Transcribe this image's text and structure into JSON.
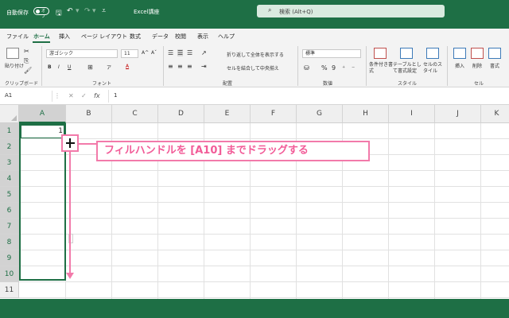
{
  "titlebar": {
    "autosave_label": "自動保存",
    "autosave_state": "オフ",
    "doc_title": "Excel講座",
    "search_placeholder": "検索 (Alt+Q)"
  },
  "menu": {
    "tabs": [
      "ファイル",
      "ホーム",
      "挿入",
      "ページ レイアウト",
      "数式",
      "データ",
      "校閲",
      "表示",
      "ヘルプ"
    ],
    "active": "ホーム"
  },
  "ribbon": {
    "clipboard": {
      "paste": "貼り付け",
      "label": "クリップボード"
    },
    "font": {
      "name": "游ゴシック",
      "size": "11",
      "label": "フォント",
      "bold": "B",
      "italic": "I",
      "underline": "U",
      "grow": "A^",
      "shrink": "Aˇ",
      "color_letter": "A",
      "highlight_letter": "ア"
    },
    "alignment": {
      "wrap": "折り返して全体を表示する",
      "merge": "セルを結合して中央揃え",
      "label": "配置"
    },
    "number": {
      "format": "標準",
      "percent": "%",
      "comma": "9",
      "label": "数値"
    },
    "styles": {
      "conditional": "条件付き書式",
      "table": "テーブルとして書式設定",
      "cell": "セルのスタイル",
      "label": "スタイル"
    },
    "cells": {
      "insert": "挿入",
      "delete": "削除",
      "format": "書式",
      "label": "セル"
    }
  },
  "formula_bar": {
    "name_box": "A1",
    "cancel": "✕",
    "enter": "✓",
    "fx": "fx",
    "value": "1"
  },
  "sheet": {
    "columns": [
      "A",
      "B",
      "C",
      "D",
      "E",
      "F",
      "G",
      "H",
      "I",
      "J",
      "K"
    ],
    "rows": [
      "1",
      "2",
      "3",
      "4",
      "5",
      "6",
      "7",
      "8",
      "9",
      "10",
      "11"
    ],
    "selected_column": "A",
    "cell_a1": "1"
  },
  "annotation": {
    "text": "フィルハンドルを [A10] までドラッグする",
    "color": "#f27aaa"
  },
  "colors": {
    "brand": "#1e6f45",
    "ribbon_bg": "#f3f3f3"
  }
}
